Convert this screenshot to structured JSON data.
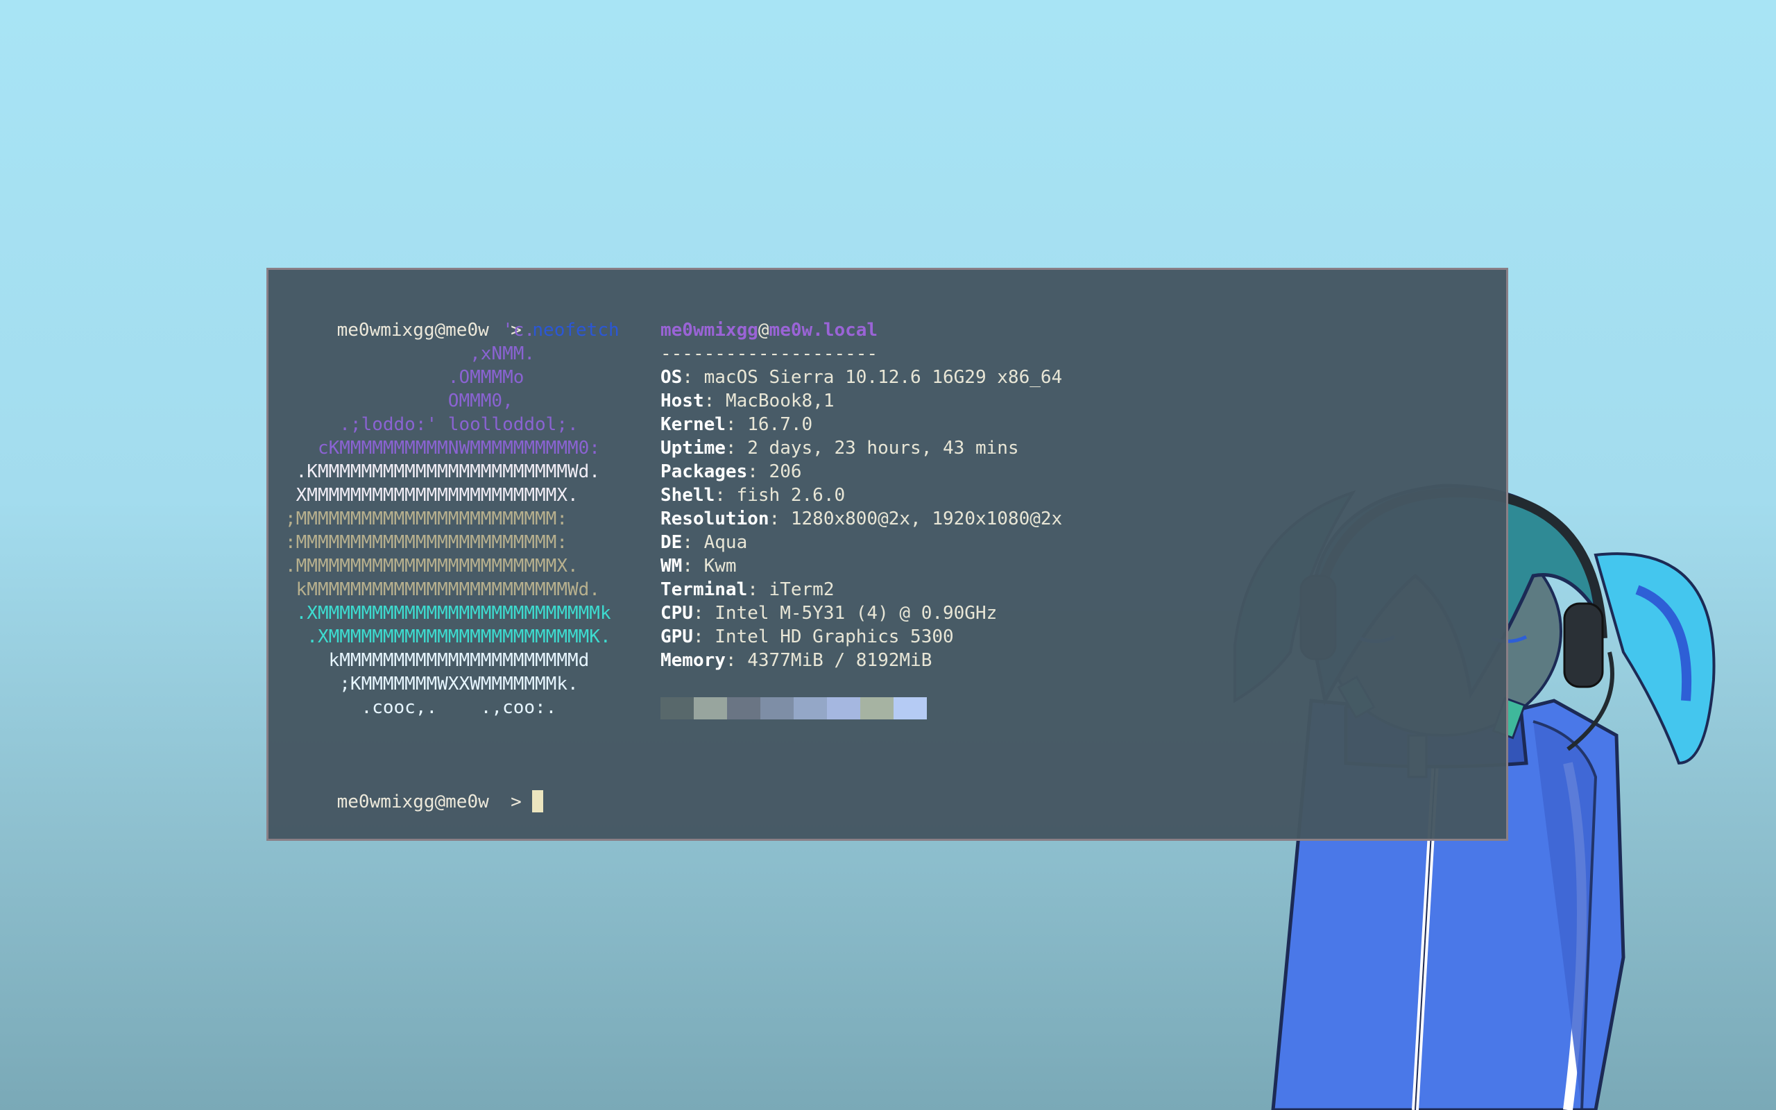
{
  "terminal": {
    "prompt_host": "me0wmixgg@me0w",
    "prompt_symbol": ">",
    "command": "neofetch",
    "logo_lines": [
      {
        "text": "                    'c.",
        "tone": "l1"
      },
      {
        "text": "                 ,xNMM.",
        "tone": "l1"
      },
      {
        "text": "               .OMMMMo",
        "tone": "l1"
      },
      {
        "text": "               OMMM0,",
        "tone": "l1"
      },
      {
        "text": "     .;loddo:' loolloddol;.",
        "tone": "l1"
      },
      {
        "text": "   cKMMMMMMMMMMNWMMMMMMMMMM0:",
        "tone": "l1"
      },
      {
        "text": " .KMMMMMMMMMMMMMMMMMMMMMMMWd.",
        "tone": "l2"
      },
      {
        "text": " XMMMMMMMMMMMMMMMMMMMMMMMX.",
        "tone": "l2"
      },
      {
        "text": ";MMMMMMMMMMMMMMMMMMMMMMMM:",
        "tone": "l3"
      },
      {
        "text": ":MMMMMMMMMMMMMMMMMMMMMMMM:",
        "tone": "l3"
      },
      {
        "text": ".MMMMMMMMMMMMMMMMMMMMMMMMX.",
        "tone": "l3"
      },
      {
        "text": " kMMMMMMMMMMMMMMMMMMMMMMMMWd.",
        "tone": "l3"
      },
      {
        "text": " .XMMMMMMMMMMMMMMMMMMMMMMMMMMk",
        "tone": "l4"
      },
      {
        "text": "  .XMMMMMMMMMMMMMMMMMMMMMMMMK.",
        "tone": "l4"
      },
      {
        "text": "    kMMMMMMMMMMMMMMMMMMMMMMd",
        "tone": "l5"
      },
      {
        "text": "     ;KMMMMMMMWXXWMMMMMMMk.",
        "tone": "l5"
      },
      {
        "text": "       .cooc,.    .,coo:.",
        "tone": "l5"
      }
    ],
    "user": "me0wmixgg",
    "at": "@",
    "hostname": "me0w.local",
    "separator": "--------------------",
    "info": [
      {
        "key": "OS",
        "value": "macOS Sierra 10.12.6 16G29 x86_64"
      },
      {
        "key": "Host",
        "value": "MacBook8,1"
      },
      {
        "key": "Kernel",
        "value": "16.7.0"
      },
      {
        "key": "Uptime",
        "value": "2 days, 23 hours, 43 mins"
      },
      {
        "key": "Packages",
        "value": "206"
      },
      {
        "key": "Shell",
        "value": "fish 2.6.0"
      },
      {
        "key": "Resolution",
        "value": "1280x800@2x, 1920x1080@2x"
      },
      {
        "key": "DE",
        "value": "Aqua"
      },
      {
        "key": "WM",
        "value": "Kwm"
      },
      {
        "key": "Terminal",
        "value": "iTerm2"
      },
      {
        "key": "CPU",
        "value": "Intel M-5Y31 (4) @ 0.90GHz"
      },
      {
        "key": "GPU",
        "value": "Intel HD Graphics 5300"
      },
      {
        "key": "Memory",
        "value": "4377MiB / 8192MiB"
      }
    ],
    "palette": [
      "#58686b",
      "#98a59e",
      "#6a7584",
      "#7e8ea6",
      "#94a7c7",
      "#a5b7e0",
      "#a6b3a2",
      "#b5cbf4"
    ],
    "colors": {
      "background": "#455762",
      "command": "#2b57d6",
      "accent": "#9a64d6"
    }
  }
}
